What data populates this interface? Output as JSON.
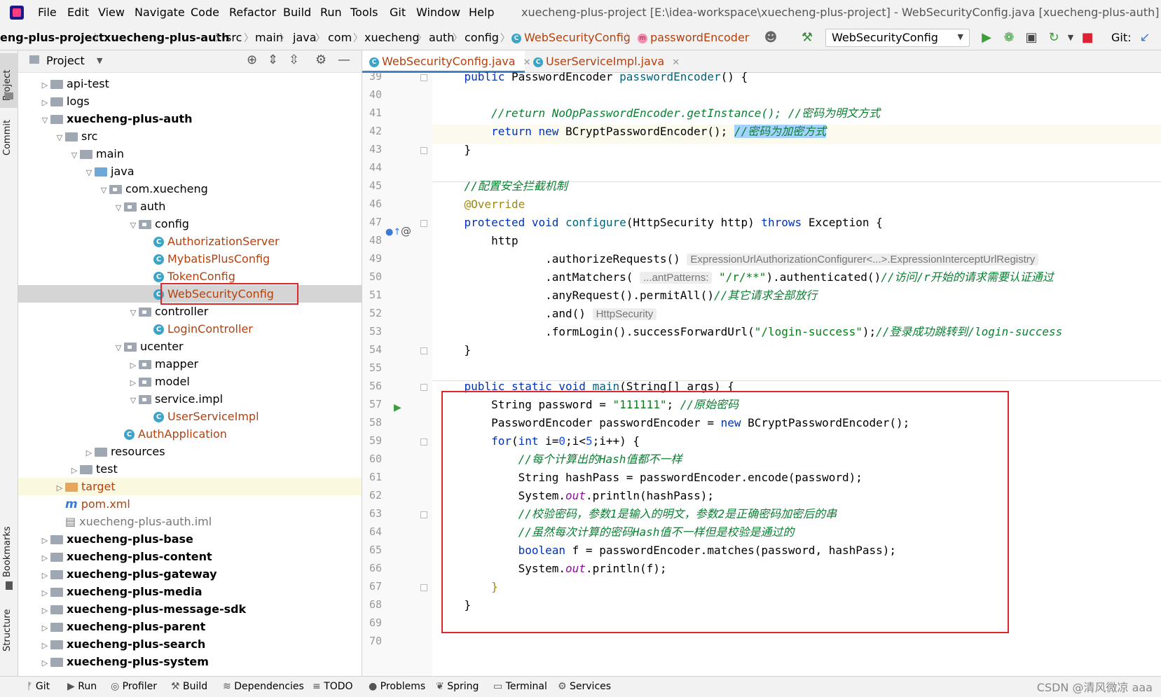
{
  "menubar": {
    "items": [
      "File",
      "Edit",
      "View",
      "Navigate",
      "Code",
      "Refactor",
      "Build",
      "Run",
      "Tools",
      "Git",
      "Window",
      "Help"
    ],
    "window_title": "xuecheng-plus-project [E:\\idea-workspace\\xuecheng-plus-project] - WebSecurityConfig.java [xuecheng-plus-auth] - Administ"
  },
  "navbar": {
    "crumbs": [
      "eng-plus-project",
      "xuecheng-plus-auth",
      "src",
      "main",
      "java",
      "com",
      "xuecheng",
      "auth",
      "config",
      "WebSecurityConfig",
      "passwordEncoder"
    ],
    "run_config": "WebSecurityConfig",
    "git_label": "Git:"
  },
  "left_stripe": {
    "project": "Project",
    "commit": "Commit",
    "bookmarks": "Bookmarks",
    "structure": "Structure"
  },
  "project_panel": {
    "title": "Project",
    "tree": [
      {
        "label": "api-test",
        "depth": 0,
        "expand": "collapsed",
        "icon": "folder",
        "style": "normal"
      },
      {
        "label": "logs",
        "depth": 0,
        "expand": "collapsed",
        "icon": "folder",
        "style": "normal"
      },
      {
        "label": "xuecheng-plus-auth",
        "depth": 0,
        "expand": "expanded",
        "icon": "folder",
        "style": "bold"
      },
      {
        "label": "src",
        "depth": 1,
        "expand": "expanded",
        "icon": "folder",
        "style": "normal"
      },
      {
        "label": "main",
        "depth": 2,
        "expand": "expanded",
        "icon": "folder",
        "style": "normal"
      },
      {
        "label": "java",
        "depth": 3,
        "expand": "expanded",
        "icon": "folder-blue",
        "style": "normal"
      },
      {
        "label": "com.xuecheng",
        "depth": 4,
        "expand": "expanded",
        "icon": "package",
        "style": "normal"
      },
      {
        "label": "auth",
        "depth": 5,
        "expand": "expanded",
        "icon": "package",
        "style": "normal"
      },
      {
        "label": "config",
        "depth": 6,
        "expand": "expanded",
        "icon": "package",
        "style": "normal"
      },
      {
        "label": "AuthorizationServer",
        "depth": 7,
        "expand": "none",
        "icon": "class",
        "style": "java"
      },
      {
        "label": "MybatisPlusConfig",
        "depth": 7,
        "expand": "none",
        "icon": "class",
        "style": "java"
      },
      {
        "label": "TokenConfig",
        "depth": 7,
        "expand": "none",
        "icon": "class",
        "style": "java"
      },
      {
        "label": "WebSecurityConfig",
        "depth": 7,
        "expand": "none",
        "icon": "class",
        "style": "java",
        "selected": true
      },
      {
        "label": "controller",
        "depth": 6,
        "expand": "expanded",
        "icon": "package",
        "style": "normal"
      },
      {
        "label": "LoginController",
        "depth": 7,
        "expand": "none",
        "icon": "class",
        "style": "java"
      },
      {
        "label": "ucenter",
        "depth": 5,
        "expand": "expanded",
        "icon": "package",
        "style": "normal"
      },
      {
        "label": "mapper",
        "depth": 6,
        "expand": "collapsed",
        "icon": "package",
        "style": "normal"
      },
      {
        "label": "model",
        "depth": 6,
        "expand": "collapsed",
        "icon": "package",
        "style": "normal"
      },
      {
        "label": "service.impl",
        "depth": 6,
        "expand": "expanded",
        "icon": "package",
        "style": "normal"
      },
      {
        "label": "UserServiceImpl",
        "depth": 7,
        "expand": "none",
        "icon": "class",
        "style": "java"
      },
      {
        "label": "AuthApplication",
        "depth": 5,
        "expand": "none",
        "icon": "class",
        "style": "java"
      },
      {
        "label": "resources",
        "depth": 3,
        "expand": "collapsed",
        "icon": "folder",
        "style": "normal"
      },
      {
        "label": "test",
        "depth": 2,
        "expand": "collapsed",
        "icon": "folder",
        "style": "normal"
      },
      {
        "label": "target",
        "depth": 1,
        "expand": "collapsed",
        "icon": "folder-orange",
        "style": "java"
      },
      {
        "label": "pom.xml",
        "depth": 1,
        "expand": "none",
        "icon": "maven",
        "style": "java"
      },
      {
        "label": "xuecheng-plus-auth.iml",
        "depth": 1,
        "expand": "none",
        "icon": "file",
        "style": "gray"
      },
      {
        "label": "xuecheng-plus-base",
        "depth": 0,
        "expand": "collapsed",
        "icon": "folder",
        "style": "bold"
      },
      {
        "label": "xuecheng-plus-content",
        "depth": 0,
        "expand": "collapsed",
        "icon": "folder",
        "style": "bold"
      },
      {
        "label": "xuecheng-plus-gateway",
        "depth": 0,
        "expand": "collapsed",
        "icon": "folder",
        "style": "bold"
      },
      {
        "label": "xuecheng-plus-media",
        "depth": 0,
        "expand": "collapsed",
        "icon": "folder",
        "style": "bold"
      },
      {
        "label": "xuecheng-plus-message-sdk",
        "depth": 0,
        "expand": "collapsed",
        "icon": "folder",
        "style": "bold"
      },
      {
        "label": "xuecheng-plus-parent",
        "depth": 0,
        "expand": "collapsed",
        "icon": "folder",
        "style": "bold"
      },
      {
        "label": "xuecheng-plus-search",
        "depth": 0,
        "expand": "collapsed",
        "icon": "folder",
        "style": "bold"
      },
      {
        "label": "xuecheng-plus-system",
        "depth": 0,
        "expand": "collapsed",
        "icon": "folder",
        "style": "bold"
      }
    ]
  },
  "editor": {
    "tabs": [
      {
        "label": "WebSecurityConfig.java",
        "active": true
      },
      {
        "label": "UserServiceImpl.java",
        "active": false
      }
    ],
    "lines": [
      {
        "n": "39",
        "segs": [
          [
            "kw",
            "    public "
          ],
          [
            "",
            "PasswordEncoder "
          ],
          [
            "fn",
            "passwordEncoder"
          ],
          [
            "",
            "() {"
          ]
        ]
      },
      {
        "n": "40",
        "segs": []
      },
      {
        "n": "41",
        "segs": [
          [
            "cmg",
            "        //return NoOpPasswordEncoder.getInstance(); //密码为明文方式"
          ]
        ]
      },
      {
        "n": "42",
        "segs": [
          [
            "kw",
            "        return new "
          ],
          [
            "",
            "BCryptPasswordEncoder(); "
          ],
          [
            "sel",
            "//密码为加密方式"
          ]
        ]
      },
      {
        "n": "43",
        "segs": [
          [
            "",
            "    }"
          ]
        ]
      },
      {
        "n": "44",
        "segs": []
      },
      {
        "n": "45",
        "segs": [
          [
            "cmg",
            "    //配置安全拦截机制"
          ]
        ]
      },
      {
        "n": "46",
        "segs": [
          [
            "ann",
            "    @Override"
          ]
        ]
      },
      {
        "n": "47",
        "segs": [
          [
            "kw",
            "    protected void "
          ],
          [
            "fn",
            "configure"
          ],
          [
            "",
            "(HttpSecurity http) "
          ],
          [
            "kw",
            "throws "
          ],
          [
            "",
            "Exception {"
          ]
        ]
      },
      {
        "n": "48",
        "segs": [
          [
            "",
            "        http"
          ]
        ]
      },
      {
        "n": "49",
        "segs": [
          [
            "",
            "                .authorizeRequests() "
          ],
          [
            "hint",
            "ExpressionUrlAuthorizationConfigurer<...>.ExpressionInterceptUrlRegistry"
          ]
        ]
      },
      {
        "n": "50",
        "segs": [
          [
            "",
            "                .antMatchers( "
          ],
          [
            "hint",
            "...antPatterns:"
          ],
          [
            "str",
            " \"/r/**\""
          ],
          [
            "",
            ").authenticated()"
          ],
          [
            "cmg",
            "//访问/r开始的请求需要认证通过"
          ]
        ]
      },
      {
        "n": "51",
        "segs": [
          [
            "",
            "                .anyRequest().permitAll()"
          ],
          [
            "cmg",
            "//其它请求全部放行"
          ]
        ]
      },
      {
        "n": "52",
        "segs": [
          [
            "",
            "                .and() "
          ],
          [
            "hint",
            "HttpSecurity"
          ]
        ]
      },
      {
        "n": "53",
        "segs": [
          [
            "",
            "                .formLogin().successForwardUrl("
          ],
          [
            "str",
            "\"/login-success\""
          ],
          [
            "",
            ");"
          ],
          [
            "cmg",
            "//登录成功跳转到/login-success"
          ]
        ]
      },
      {
        "n": "54",
        "segs": [
          [
            "",
            "    }"
          ]
        ]
      },
      {
        "n": "55",
        "segs": []
      },
      {
        "n": "56",
        "segs": [
          [
            "kw",
            "    public static void "
          ],
          [
            "fn",
            "main"
          ],
          [
            "",
            "(String[] args) {"
          ]
        ]
      },
      {
        "n": "57",
        "segs": [
          [
            "",
            "        String password = "
          ],
          [
            "str",
            "\"111111\""
          ],
          [
            "",
            "; "
          ],
          [
            "cmg",
            "//原始密码"
          ]
        ]
      },
      {
        "n": "58",
        "segs": [
          [
            "",
            "        PasswordEncoder passwordEncoder = "
          ],
          [
            "kw",
            "new "
          ],
          [
            "",
            "BCryptPasswordEncoder();"
          ]
        ]
      },
      {
        "n": "59",
        "segs": [
          [
            "kw",
            "        for"
          ],
          [
            "",
            "("
          ],
          [
            "kw",
            "int "
          ],
          [
            "",
            "i="
          ],
          [
            "num",
            "0"
          ],
          [
            "",
            ";i<"
          ],
          [
            "num",
            "5"
          ],
          [
            "",
            ";i++) {"
          ]
        ]
      },
      {
        "n": "60",
        "segs": [
          [
            "cmg",
            "            //每个计算出的Hash值都不一样"
          ]
        ]
      },
      {
        "n": "61",
        "segs": [
          [
            "",
            "            String hashPass = passwordEncoder.encode(password);"
          ]
        ]
      },
      {
        "n": "62",
        "segs": [
          [
            "",
            "            System."
          ],
          [
            "ital",
            "out"
          ],
          [
            "",
            ".println(hashPass);"
          ]
        ]
      },
      {
        "n": "63",
        "segs": [
          [
            "cmg",
            "            //校验密码，参数1是输入的明文，参数2是正确密码加密后的串"
          ]
        ]
      },
      {
        "n": "64",
        "segs": [
          [
            "cmg",
            "            //虽然每次计算的密码Hash值不一样但是校验是通过的"
          ]
        ]
      },
      {
        "n": "65",
        "segs": [
          [
            "kw",
            "            boolean "
          ],
          [
            "",
            "f = passwordEncoder.matches(password, hashPass);"
          ]
        ]
      },
      {
        "n": "66",
        "segs": [
          [
            "",
            "            System."
          ],
          [
            "ital",
            "out"
          ],
          [
            "",
            ".println(f);"
          ]
        ]
      },
      {
        "n": "67",
        "segs": [
          [
            "ann",
            "        }"
          ]
        ]
      },
      {
        "n": "68",
        "segs": [
          [
            "",
            "    }"
          ]
        ]
      },
      {
        "n": "69",
        "segs": []
      },
      {
        "n": "70",
        "segs": []
      }
    ]
  },
  "bottombar": {
    "tools": [
      "Git",
      "Run",
      "Profiler",
      "Build",
      "Dependencies",
      "TODO",
      "Problems",
      "Spring",
      "Terminal",
      "Services"
    ],
    "watermark": "CSDN @清风微凉 aaa"
  }
}
